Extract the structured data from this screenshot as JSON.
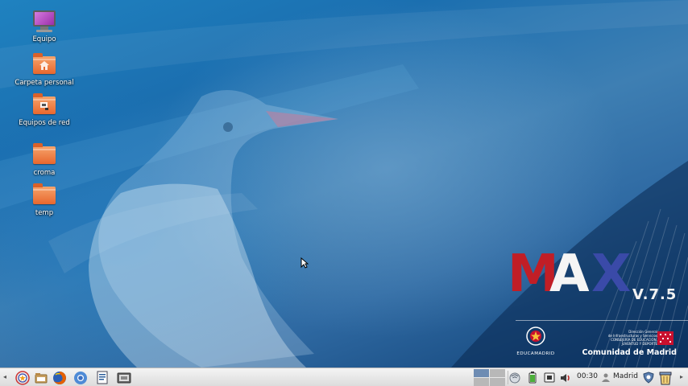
{
  "desktop": {
    "icons": [
      {
        "label": "Equipo",
        "icon": "computer-icon"
      },
      {
        "label": "Carpeta personal",
        "icon": "home-folder-icon"
      },
      {
        "label": "Equipos de red",
        "icon": "network-folder-icon"
      },
      {
        "label": "croma",
        "icon": "folder-icon"
      },
      {
        "label": "temp",
        "icon": "folder-icon"
      }
    ]
  },
  "branding": {
    "logo_letters": [
      "M",
      "A",
      "X"
    ],
    "version": "V.7.5",
    "educamadrid_text": "EDUCAMADRID",
    "cm_lines": [
      "Dirección General",
      "de Infraestructuras y Servicios",
      "CONSEJERÍA DE EDUCACIÓN,",
      "JUVENTUD Y DEPORTE"
    ],
    "cm_name": "Comunidad de Madrid",
    "colors": {
      "m": "#c11e26",
      "a": "#f5f5f5",
      "x": "#3a4aa8"
    }
  },
  "taskbar": {
    "launchers": [
      {
        "name": "main-menu-icon"
      },
      {
        "name": "file-manager-icon"
      },
      {
        "name": "firefox-icon"
      },
      {
        "name": "chromium-icon"
      },
      {
        "name": "text-editor-icon"
      },
      {
        "name": "screenshot-icon"
      }
    ],
    "tray": [
      {
        "name": "network-icon"
      },
      {
        "name": "battery-icon"
      },
      {
        "name": "screen-icon"
      },
      {
        "name": "volume-icon"
      }
    ],
    "clock": "00:30",
    "user": "Madrid"
  }
}
